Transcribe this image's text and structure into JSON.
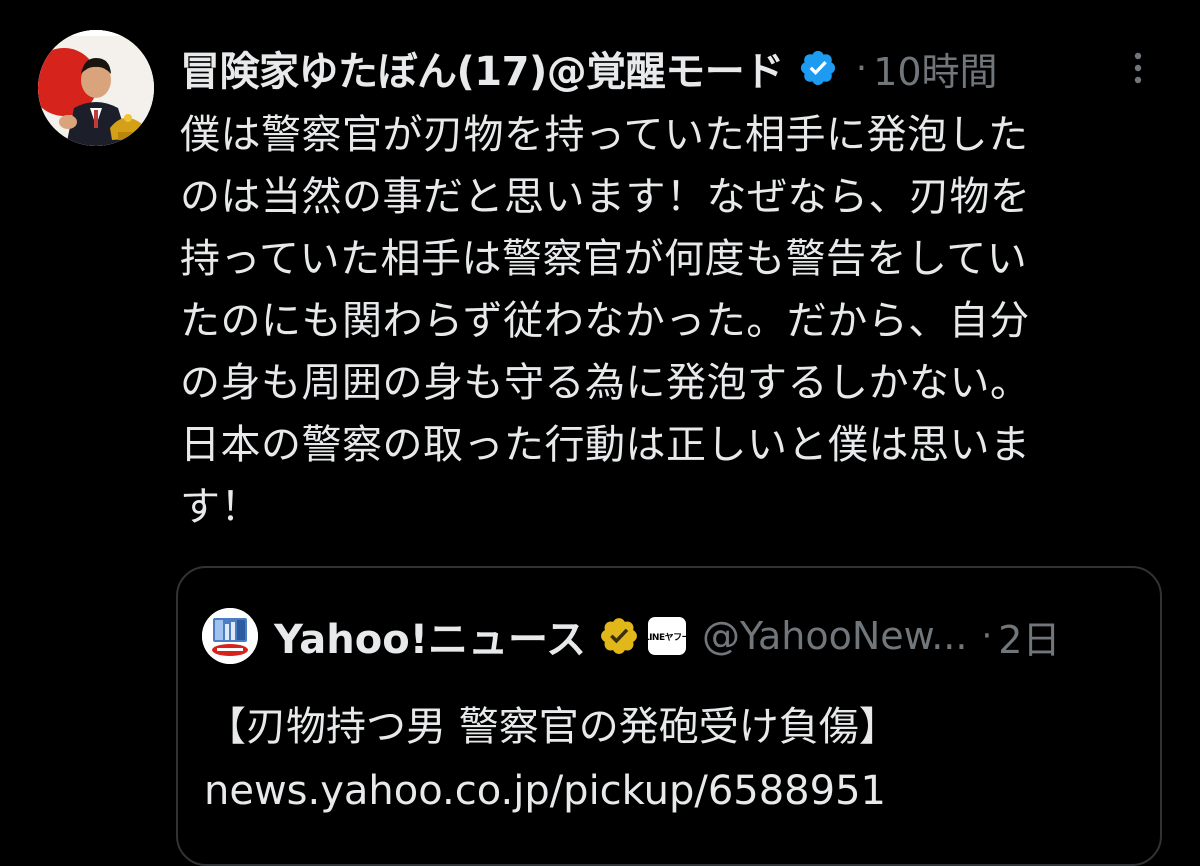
{
  "tweet": {
    "author": {
      "display_name": "冒険家ゆたぼん(17)@覚醒モード",
      "verified_icon": "verified-badge-icon",
      "avatar_icon": "avatar"
    },
    "dot": "·",
    "time": "10時間",
    "more_icon": "more-vertical-icon",
    "text": "僕は警察官が刃物を持っていた相手に発泡した\nのは当然の事だと思います！なぜなら、刃物を\n持っていた相手は警察官が何度も警告をしてい\nたのにも関わらず従わなかった。だから、自分\nの身も周囲の身も守る為に発泡するしかない。\n日本の警察の取った行動は正しいと僕は思いま\nす！"
  },
  "quote": {
    "author": {
      "display_name": "Yahoo!ニュース",
      "badge_icon": "gold-verified-badge-icon",
      "affiliation_label": "LINEヤフー",
      "handle": "@YahooNew..."
    },
    "dot": "·",
    "time": "2日",
    "headline": "【刃物持つ男 警察官の発砲受け負傷】",
    "link": "news.yahoo.co.jp/pickup/6588951"
  },
  "colors": {
    "background": "#000000",
    "text": "#e7e9ea",
    "secondary": "#71767b",
    "verified_blue": "#1d9bf0",
    "gold_badge": "#e2b719",
    "border": "#2f3336"
  }
}
